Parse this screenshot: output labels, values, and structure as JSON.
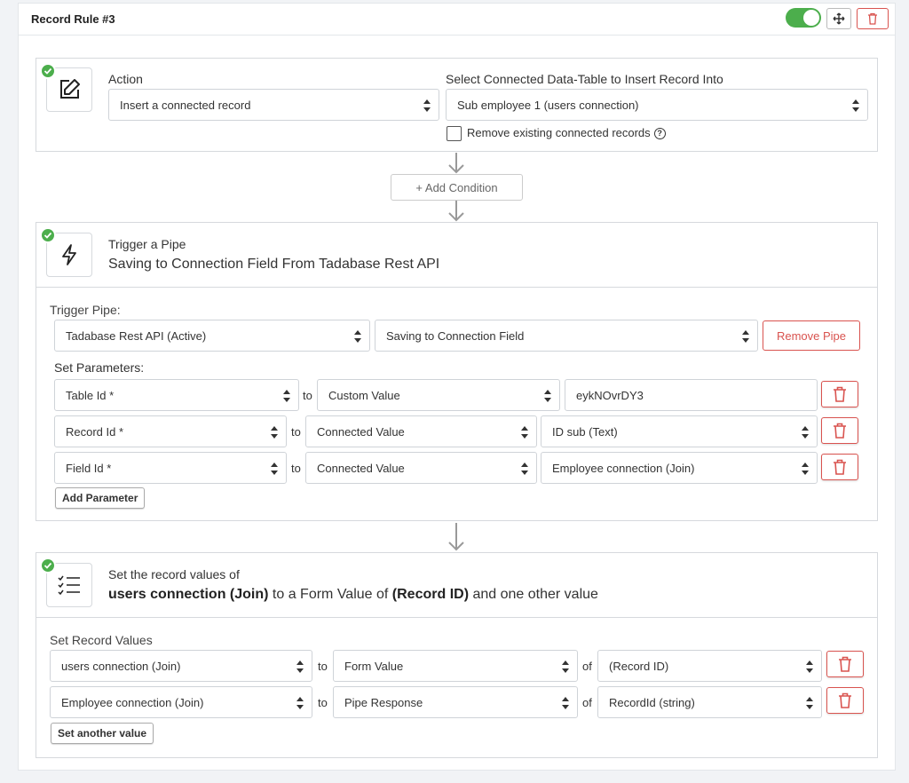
{
  "rule": {
    "title": "Record Rule #3",
    "enabled": true
  },
  "colors": {
    "accent_green": "#4cae4c",
    "danger_red": "#d9534f",
    "border": "#d6d9dd"
  },
  "action_panel": {
    "action_label": "Action",
    "action_value": "Insert a connected record",
    "table_label": "Select Connected Data-Table to Insert Record Into",
    "table_value": "Sub employee 1 (users connection)",
    "remove_label": "Remove existing connected records",
    "remove_checked": false,
    "icon": "edit-icon"
  },
  "add_condition_label": "+ Add Condition",
  "pipe_panel": {
    "heading": "Trigger a Pipe",
    "subheading": "Saving to Connection Field From Tadabase Rest API",
    "trigger_label": "Trigger Pipe:",
    "pipe_value": "Tadabase Rest API (Active)",
    "function_value": "Saving to Connection Field",
    "remove_button": "Remove Pipe",
    "params_label": "Set Parameters:",
    "params": [
      {
        "name": "Table Id *",
        "to": "to",
        "source": "Custom Value",
        "value": "eykNOvrDY3"
      },
      {
        "name": "Record Id *",
        "to": "to",
        "source": "Connected Value",
        "value": "ID sub (Text)"
      },
      {
        "name": "Field Id *",
        "to": "to",
        "source": "Connected Value",
        "value": "Employee connection (Join)"
      }
    ],
    "add_param_button": "Add Parameter",
    "icon": "bolt-icon"
  },
  "values_panel": {
    "heading": "Set the record values of",
    "summary_bold1": "users connection (Join)",
    "summary_mid": " to a Form Value of ",
    "summary_bold2": "(Record ID)",
    "summary_end": " and one other value",
    "set_label": "Set Record Values",
    "rows": [
      {
        "field": "users connection (Join)",
        "to": "to",
        "source": "Form Value",
        "of": "of",
        "value": "(Record ID)"
      },
      {
        "field": "Employee connection (Join)",
        "to": "to",
        "source": "Pipe Response",
        "of": "of",
        "value": "RecordId (string)"
      }
    ],
    "another_button": "Set another value",
    "icon": "checklist-icon"
  }
}
